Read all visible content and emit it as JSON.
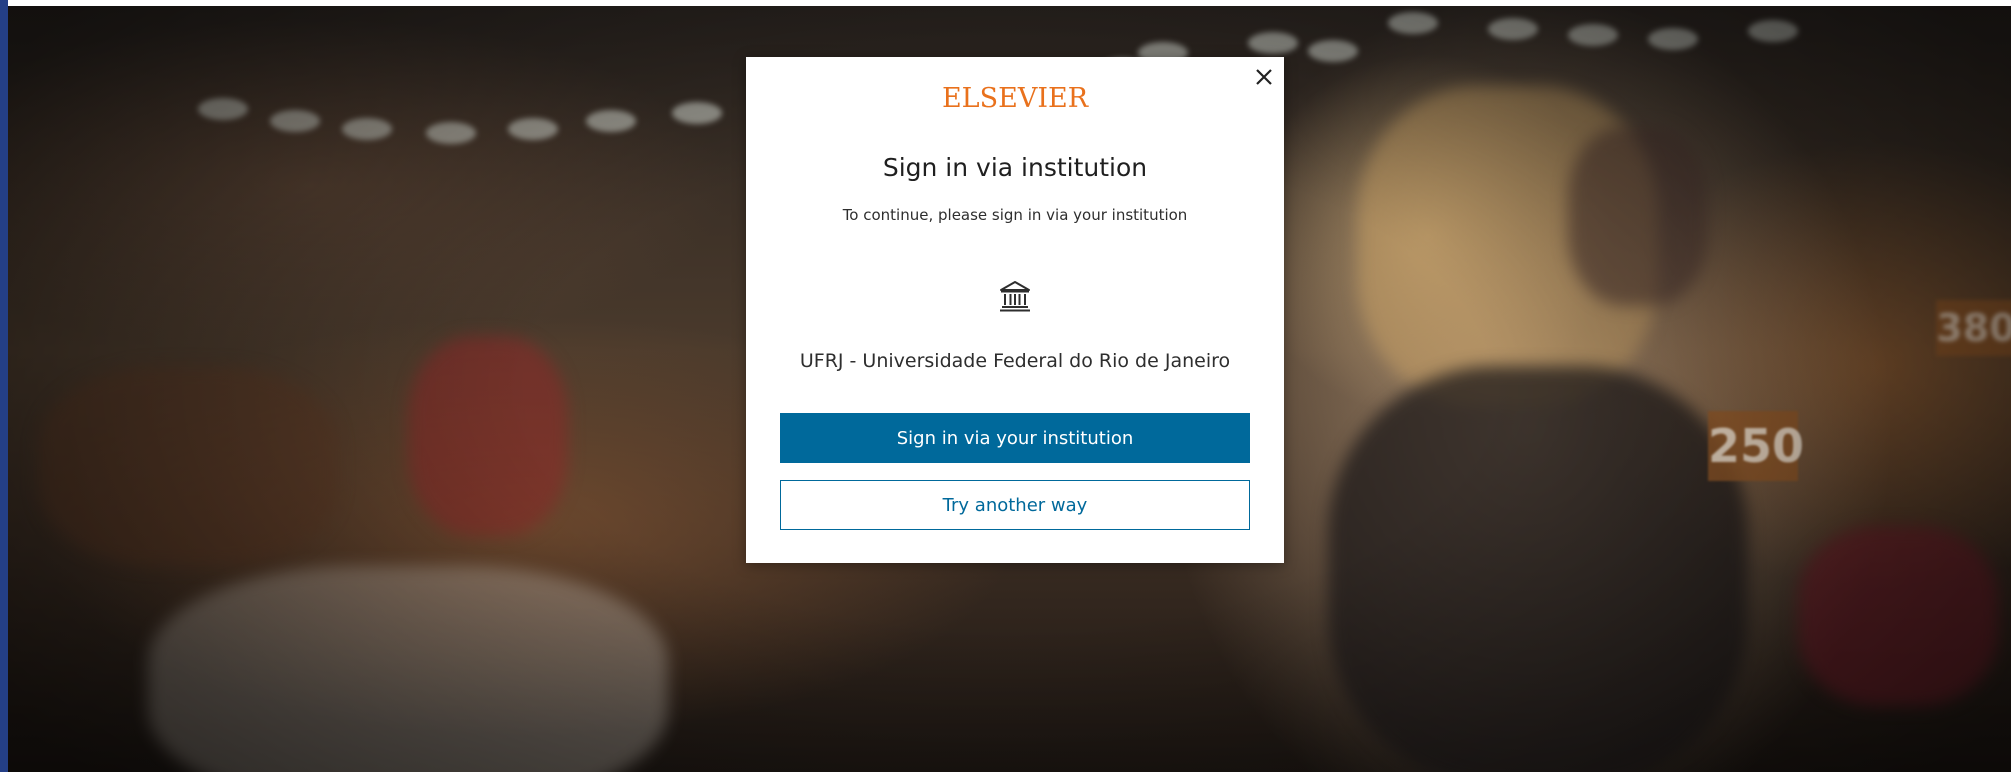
{
  "modal": {
    "logo_text": "ELSEVIER",
    "title": "Sign in via institution",
    "subtitle": "To continue, please sign in via your institution",
    "institution_icon": "institution-building-icon",
    "institution_name": "UFRJ - Universidade Federal do Rio de Janeiro",
    "primary_button": "Sign in via your institution",
    "secondary_button": "Try another way",
    "close_icon": "close-icon"
  },
  "colors": {
    "brand_orange": "#e9711c",
    "primary_blue": "#00699b",
    "text_dark": "#1f1f1f"
  }
}
